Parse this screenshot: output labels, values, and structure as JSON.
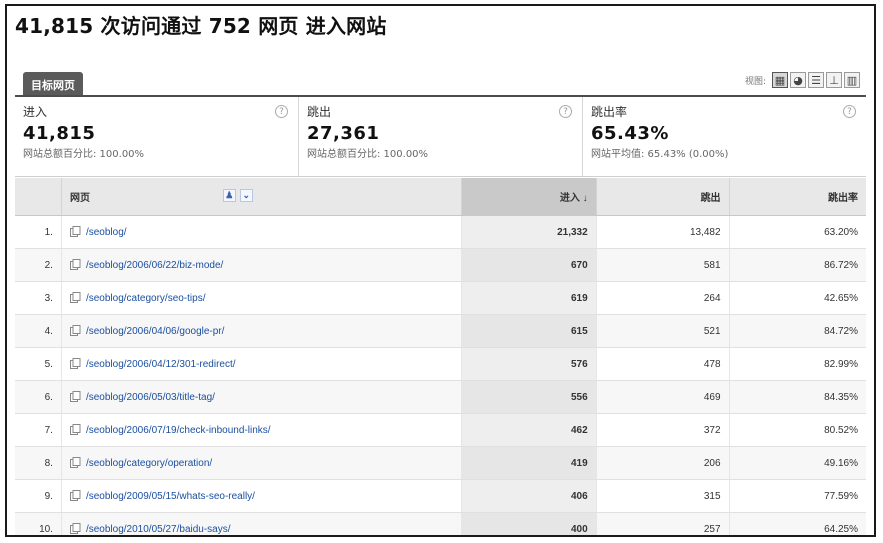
{
  "title": "41,815 次访问通过 752 网页 进入网站",
  "tab": {
    "label": "目标网页"
  },
  "view_controls": {
    "label": "视图:",
    "buttons": [
      {
        "icon": "table-view-icon",
        "active": true
      },
      {
        "icon": "pie-view-icon",
        "active": false
      },
      {
        "icon": "bar-view-icon",
        "active": false
      },
      {
        "icon": "comparison-view-icon",
        "active": false
      },
      {
        "icon": "pivot-view-icon",
        "active": false
      }
    ]
  },
  "summary": [
    {
      "label": "进入",
      "value": "41,815",
      "sub": "网站总额百分比: 100.00%"
    },
    {
      "label": "跳出",
      "value": "27,361",
      "sub": "网站总额百分比: 100.00%"
    },
    {
      "label": "跳出率",
      "value": "65.43%",
      "sub": "网站平均值: 65.43% (0.00%)"
    }
  ],
  "table": {
    "headers": {
      "page": "网页",
      "entrances": "进入 ↓",
      "bounces": "跳出",
      "bounce_rate": "跳出率"
    },
    "rows": [
      {
        "idx": "1.",
        "page": "/seoblog/",
        "entrances": "21,332",
        "bounces": "13,482",
        "rate": "63.20%"
      },
      {
        "idx": "2.",
        "page": "/seoblog/2006/06/22/biz-mode/",
        "entrances": "670",
        "bounces": "581",
        "rate": "86.72%"
      },
      {
        "idx": "3.",
        "page": "/seoblog/category/seo-tips/",
        "entrances": "619",
        "bounces": "264",
        "rate": "42.65%"
      },
      {
        "idx": "4.",
        "page": "/seoblog/2006/04/06/google-pr/",
        "entrances": "615",
        "bounces": "521",
        "rate": "84.72%"
      },
      {
        "idx": "5.",
        "page": "/seoblog/2006/04/12/301-redirect/",
        "entrances": "576",
        "bounces": "478",
        "rate": "82.99%"
      },
      {
        "idx": "6.",
        "page": "/seoblog/2006/05/03/title-tag/",
        "entrances": "556",
        "bounces": "469",
        "rate": "84.35%"
      },
      {
        "idx": "7.",
        "page": "/seoblog/2006/07/19/check-inbound-links/",
        "entrances": "462",
        "bounces": "372",
        "rate": "80.52%"
      },
      {
        "idx": "8.",
        "page": "/seoblog/category/operation/",
        "entrances": "419",
        "bounces": "206",
        "rate": "49.16%"
      },
      {
        "idx": "9.",
        "page": "/seoblog/2009/05/15/whats-seo-really/",
        "entrances": "406",
        "bounces": "315",
        "rate": "77.59%"
      },
      {
        "idx": "10.",
        "page": "/seoblog/2010/05/27/baidu-says/",
        "entrances": "400",
        "bounces": "257",
        "rate": "64.25%"
      }
    ]
  }
}
